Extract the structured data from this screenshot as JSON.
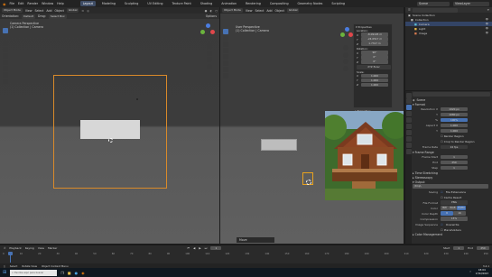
{
  "topbar": {
    "menus": [
      "File",
      "Edit",
      "Render",
      "Window",
      "Help"
    ],
    "workspaces": [
      "Layout",
      "Modeling",
      "Sculpting",
      "UV Editing",
      "Texture Paint",
      "Shading",
      "Animation",
      "Rendering",
      "Compositing",
      "Geometry Nodes",
      "Scripting"
    ],
    "active_workspace": "Layout",
    "scene": "Scene",
    "view_layer": "ViewLayer"
  },
  "left_viewport": {
    "mode": "Object Mode",
    "menus": [
      "View",
      "Select",
      "Add",
      "Object"
    ],
    "orientation": "Global",
    "toolbar2": [
      "Orientation:",
      "Default",
      "Drag:",
      "Select Box"
    ],
    "options": "Options",
    "title": "Camera Perspective",
    "subtitle": "(1) Collection | Camera"
  },
  "right_viewport": {
    "mode": "Object Mode",
    "menus": [
      "View",
      "Select",
      "Add",
      "Object"
    ],
    "orientation": "Global",
    "title": "User Perspective",
    "subtitle": "(1) Collection | Camera",
    "status": "Move"
  },
  "npanel": {
    "header": "Properties",
    "location_label": "Location:",
    "location": [
      "-8.09195 m",
      "-24.0517 m",
      "1.7317 m"
    ],
    "rotation_label": "Rotation:",
    "rotation": [
      "90°",
      "0°",
      "0°"
    ],
    "rotation_mode": "XYZ Euler",
    "scale_label": "Scale:",
    "scale": [
      "1.000",
      "1.000",
      "1.000"
    ],
    "axes": [
      "X",
      "Y",
      "Z"
    ],
    "footer": "Properties"
  },
  "outliner": {
    "title": "Scene Collection",
    "items": [
      {
        "name": "Collection",
        "color": "#b0b0b0"
      },
      {
        "name": "Camera",
        "color": "#5dbcd2"
      },
      {
        "name": "Light",
        "color": "#e6b94a"
      },
      {
        "name": "Image",
        "color": "#d97b4f"
      }
    ]
  },
  "properties_editor": {
    "scene": "Scene",
    "format_header": "Format",
    "resolution_x_label": "Resolution X",
    "resolution_x": "1920 px",
    "resolution_y_label": "Y",
    "resolution_y": "1080 px",
    "percent_label": "%",
    "percent": "100%",
    "aspect_x_label": "Aspect X",
    "aspect_x": "1.000",
    "aspect_y_label": "Y",
    "aspect_y": "1.000",
    "render_region": "Render Region",
    "crop": "Crop to Render Region",
    "frame_rate_label": "Frame Rate",
    "frame_rate": "24 fps",
    "frame_range_header": "Frame Range",
    "frame_start_label": "Frame Start",
    "frame_start": "1",
    "end_label": "End",
    "end": "250",
    "step_label": "Step",
    "step": "1",
    "time_stretching": "Time Stretching",
    "stereoscopy": "Stereoscopy",
    "output_header": "Output",
    "output_path": "/tmp\\",
    "saving_label": "Saving",
    "file_extensions": "File Extensions",
    "cache_result": "Cache Result",
    "file_format_label": "File Format",
    "file_format": "PNG",
    "color_label": "Color",
    "color_opts": [
      "BW",
      "RGB",
      "RGBA"
    ],
    "color_depth_label": "Color Depth",
    "color_depth": [
      "8",
      "16"
    ],
    "compression_label": "Compression",
    "compression": "15%",
    "image_sequence_label": "Image Sequence",
    "overwrite": "Overwrite",
    "placeholders": "Placeholders",
    "color_management": "Color Management"
  },
  "timeline": {
    "menus": [
      "Playback",
      "Keying",
      "View",
      "Marker"
    ],
    "ticks": [
      "0",
      "10",
      "20",
      "30",
      "40",
      "50",
      "60",
      "70",
      "80",
      "90",
      "100",
      "110",
      "120",
      "130",
      "140",
      "150",
      "160",
      "170",
      "180",
      "190",
      "200",
      "210",
      "220",
      "230",
      "240",
      "250"
    ],
    "current_frame": "1",
    "start_label": "Start",
    "start": "1",
    "end_label": "End",
    "end": "250"
  },
  "statusbar": {
    "select": "Select",
    "rotate": "Rotate View",
    "context": "Object Context Menu",
    "version": "3.4.1"
  },
  "taskbar": {
    "search_placeholder": "Escribe aquí para buscar",
    "time": "18:04",
    "date": "17/02/2023"
  },
  "colors": {
    "accent": "#4772b3",
    "camera_frame": "#d98a2a",
    "bg_dark": "#1d1d1d",
    "viewport_top": "#3b3b3b",
    "viewport_bottom": "#5d5d5d"
  }
}
